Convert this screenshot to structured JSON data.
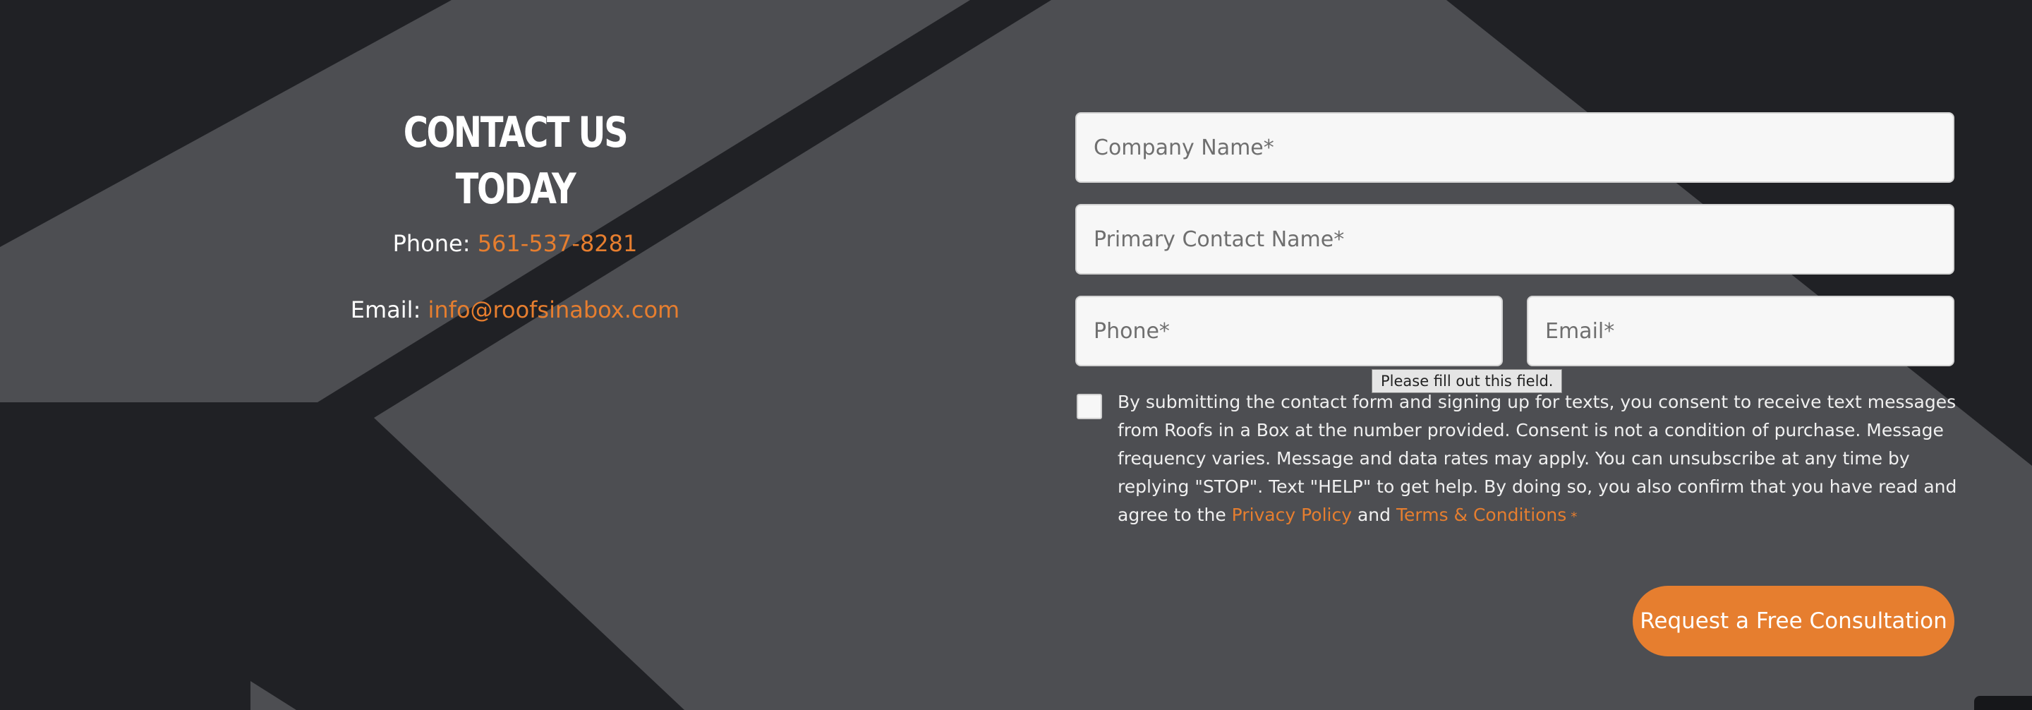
{
  "contact": {
    "heading": "CONTACT US TODAY",
    "phone_label": "Phone: ",
    "phone_value": "561-537-8281",
    "email_label": "Email: ",
    "email_value": "info@roofsinabox.com"
  },
  "form": {
    "company_placeholder": "Company Name*",
    "contact_placeholder": "Primary Contact Name*",
    "phone_placeholder": "Phone*",
    "email_placeholder": "Email*",
    "validation_tooltip": "Please fill out this field.",
    "consent_text": "By submitting the contact form and signing up for texts, you consent to receive text messages from Roofs in a Box at the number provided. Consent is not a condition of purchase. Message frequency varies. Message and data rates may apply. You can unsubscribe at any time by replying \"STOP\". Text \"HELP\" to get help. By doing so, you also confirm that you have read and agree to the ",
    "privacy_link": "Privacy Policy",
    "and_text": " and ",
    "terms_link": "Terms & Conditions",
    "required_mark": "*",
    "submit_label": "Request a Free Consultation"
  },
  "colors": {
    "background": "#202125",
    "shape": "#4d4e52",
    "accent": "#e67e2f",
    "field_bg": "#f7f7f7"
  }
}
